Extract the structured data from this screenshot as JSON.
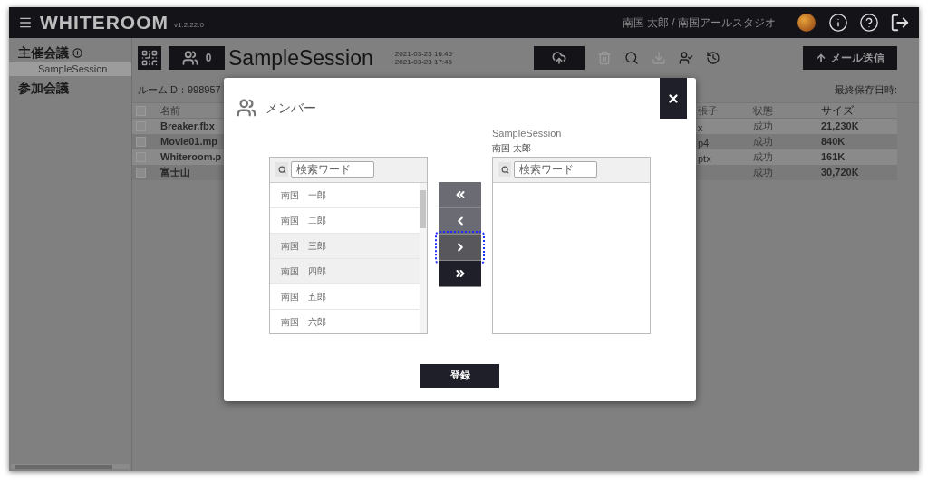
{
  "header": {
    "app_name": "WHITEROOM",
    "version": "v1.2.22.0",
    "user": "南国 太郎 / 南国アールスタジオ"
  },
  "sidebar": {
    "hosted": {
      "label": "主催会議",
      "items": [
        {
          "label": "SampleSession",
          "selected": true
        }
      ]
    },
    "joined": {
      "label": "参加会議"
    }
  },
  "session": {
    "member_count": "0",
    "title": "SampleSession",
    "start": "2021-03-23 16:45",
    "end": "2021-03-23 17:45",
    "mail_button": "メール送信",
    "room_id": "ルームID：998957",
    "last_saved": "最終保存日時:"
  },
  "toolbar": [
    {
      "kind": "trash",
      "disabled": true
    },
    {
      "kind": "search",
      "disabled": false
    },
    {
      "kind": "download",
      "disabled": true
    },
    {
      "kind": "user-check",
      "disabled": false
    },
    {
      "kind": "history",
      "disabled": false
    }
  ],
  "table": {
    "columns": [
      "名前",
      "張子",
      "状態",
      "サイズ"
    ],
    "header_checked": false,
    "rows": [
      {
        "checked": false,
        "cells": [
          "Breaker.fbx",
          "x",
          "成功",
          "21,230K"
        ]
      },
      {
        "checked": false,
        "cells": [
          "Movie01.mp",
          "p4",
          "成功",
          "840K"
        ]
      },
      {
        "checked": false,
        "cells": [
          "Whiteroom.p",
          "ptx",
          "成功",
          "161K"
        ]
      },
      {
        "checked": false,
        "cells": [
          "富士山",
          null,
          "成功",
          "30,720K"
        ]
      }
    ]
  },
  "dialog": {
    "title": "メンバー",
    "available": {
      "search_placeholder": "検索ワード",
      "members": [
        {
          "name": "南国　一郎",
          "selected": false
        },
        {
          "name": "南国　二郎",
          "selected": false
        },
        {
          "name": "南国　三郎",
          "selected": true
        },
        {
          "name": "南国　四郎",
          "selected": true
        },
        {
          "name": "南国　五郎",
          "selected": false
        },
        {
          "name": "南国　六郎",
          "selected": false
        }
      ]
    },
    "session": {
      "title": "SampleSession",
      "owner": "南国 太郎",
      "search_placeholder": "検索ワード"
    },
    "transfer_buttons": [
      {
        "kind": "all-left",
        "disabled": true,
        "focused": false
      },
      {
        "kind": "left",
        "disabled": true,
        "focused": false
      },
      {
        "kind": "right",
        "disabled": false,
        "focused": true
      },
      {
        "kind": "all-right",
        "disabled": false,
        "focused": false
      }
    ],
    "submit": "登録"
  }
}
